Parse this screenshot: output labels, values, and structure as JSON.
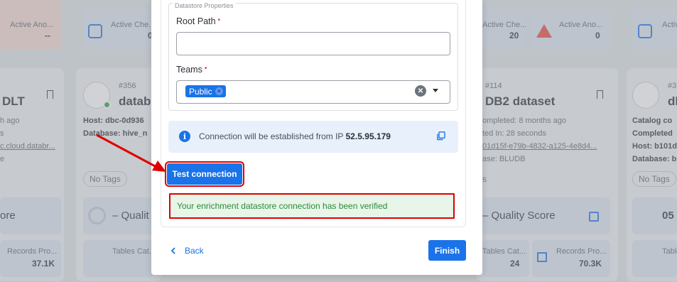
{
  "background": {
    "cards": [
      {
        "title": "DLT",
        "lines": [
          "h ago",
          "s",
          "c.cloud.databr...",
          "e"
        ],
        "stats": [
          "Active Ano...",
          "--"
        ],
        "tags": "",
        "quality": "ore",
        "bottom": [
          "Records Pro...",
          "37.1K"
        ]
      },
      {
        "number": "#356",
        "title": "datab",
        "lines": [
          "Host: dbc-0d936",
          "Database: hive_n"
        ],
        "stats": [
          "Active Che...",
          "0"
        ],
        "tags": "No Tags",
        "quality": "– Qualit",
        "bottom": [
          "Tables Cat...",
          "–"
        ]
      },
      {
        "number": "#114",
        "title": "DB2 dataset",
        "lines": [
          "ompleted: 8 months ago",
          "ted In: 28 seconds",
          "01d15f-e79b-4832-a125-4e8d4...",
          "ase: BLUDB"
        ],
        "stats": [
          "Active Che...",
          "20",
          "Active Ano...",
          "0"
        ],
        "tags": "s",
        "quality": "– Quality Score",
        "bottom": [
          "Tables Cat...",
          "24",
          "Records Pro...",
          "70.3K"
        ]
      },
      {
        "number": "#3",
        "title": "db",
        "lines": [
          "Catalog co",
          "Completed",
          "Host: b101d",
          "Database: b"
        ],
        "stats": [
          "Active Che..."
        ],
        "tags": "No Tags",
        "quality": "05",
        "bottom": [
          "Tables"
        ]
      }
    ]
  },
  "modal": {
    "section_legend": "Datastore Properties",
    "root_path": {
      "label": "Root Path",
      "value": "",
      "required_marker": "•"
    },
    "teams": {
      "label": "Teams",
      "required_marker": "•",
      "selected": [
        "Public"
      ],
      "clear_icon": "clear-icon",
      "dropdown_icon": "caret-down-icon"
    },
    "info": {
      "text": "Connection will be established from IP",
      "ip": "52.5.95.179",
      "icon": "info-icon",
      "copy_icon": "copy-icon"
    },
    "test_button": "Test connection",
    "success_message": "Your enrichment datastore connection has been verified",
    "back_label": "Back",
    "finish_label": "Finish"
  },
  "colors": {
    "accent": "#1a73e8",
    "success_bg": "#e7f6e9",
    "success_text": "#2d8a3a",
    "highlight": "#e00000",
    "warning": "#e8473c"
  }
}
